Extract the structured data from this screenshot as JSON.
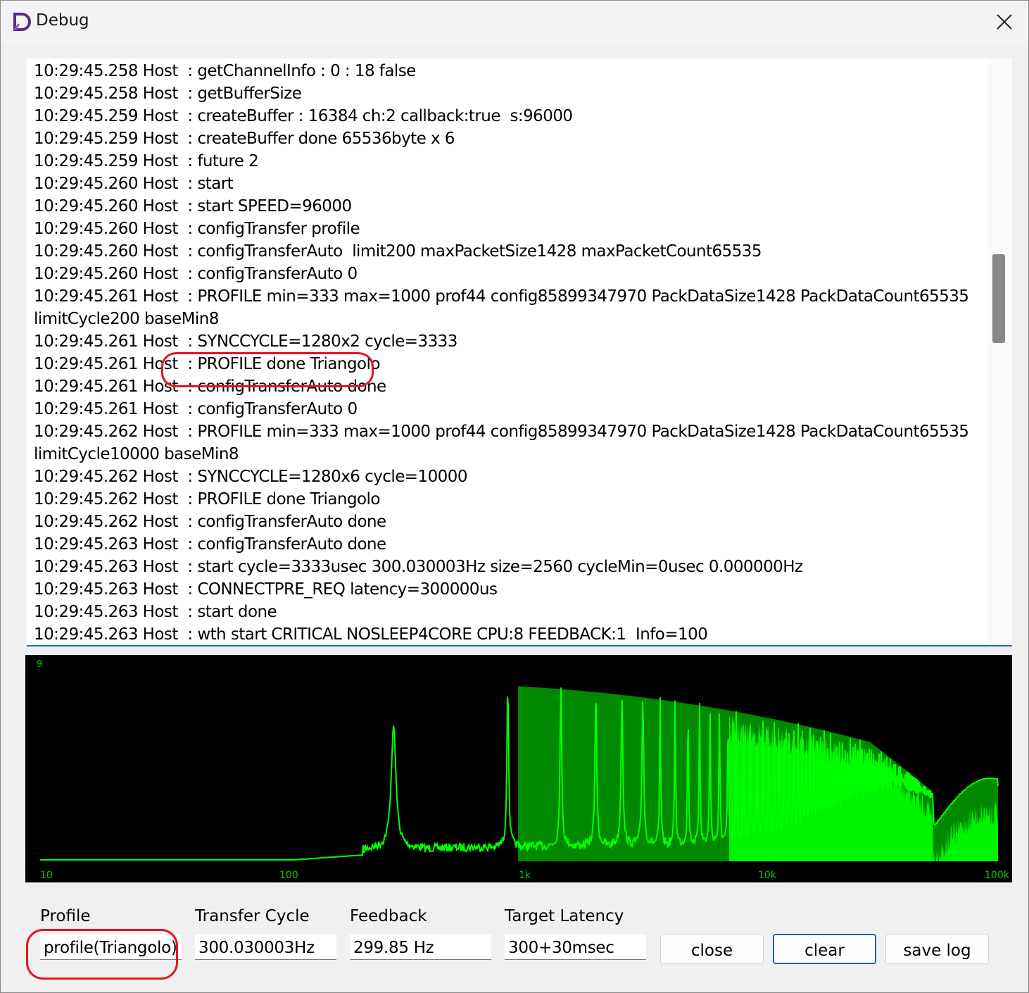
{
  "window": {
    "title": "Debug",
    "colors": {
      "brand": "#5b2a86",
      "spectrum_line": "#00ff00",
      "spectrum_fill": "#008800",
      "annotation": "#e8141e",
      "focus_border": "#1f5fa8"
    }
  },
  "log": {
    "lines": [
      "10:29:45.258 Host  : getChannelInfo : 0 : 18 false",
      "10:29:45.258 Host  : getBufferSize",
      "10:29:45.259 Host  : createBuffer : 16384 ch:2 callback:true  s:96000",
      "10:29:45.259 Host  : createBuffer done 65536byte x 6",
      "10:29:45.259 Host  : future 2",
      "10:29:45.260 Host  : start",
      "10:29:45.260 Host  : start SPEED=96000",
      "10:29:45.260 Host  : configTransfer profile",
      "10:29:45.260 Host  : configTransferAuto  limit200 maxPacketSize1428 maxPacketCount65535",
      "10:29:45.260 Host  : configTransferAuto 0",
      "10:29:45.261 Host  : PROFILE min=333 max=1000 prof44 config85899347970 PackDataSize1428 PackDataCount65535",
      "limitCycle200 baseMin8",
      "10:29:45.261 Host  : SYNCCYCLE=1280x2 cycle=3333",
      "10:29:45.261 Host  : PROFILE done Triangolo",
      "10:29:45.261 Host  : configTransferAuto done",
      "10:29:45.261 Host  : configTransferAuto 0",
      "10:29:45.262 Host  : PROFILE min=333 max=1000 prof44 config85899347970 PackDataSize1428 PackDataCount65535",
      "limitCycle10000 baseMin8",
      "10:29:45.262 Host  : SYNCCYCLE=1280x6 cycle=10000",
      "10:29:45.262 Host  : PROFILE done Triangolo",
      "10:29:45.262 Host  : configTransferAuto done",
      "10:29:45.263 Host  : configTransferAuto done",
      "10:29:45.263 Host  : start cycle=3333usec 300.030003Hz size=2560 cycleMin=0usec 0.000000Hz",
      "10:29:45.263 Host  : CONNECTPRE_REQ latency=300000us",
      "10:29:45.263 Host  : start done",
      "10:29:45.263 Host  : wth start CRITICAL NOSLEEP4CORE CPU:8 FEEDBACK:1  Info=100"
    ]
  },
  "spectrum": {
    "y_label": "9",
    "x_ticks": [
      "10",
      "100",
      "1k",
      "10k",
      "100k"
    ],
    "x_scale": "log",
    "x_range": [
      10,
      100000
    ]
  },
  "fields": {
    "profile": {
      "label": "Profile",
      "value": "profile(Triangolo)"
    },
    "transfer_cycle": {
      "label": "Transfer Cycle",
      "value": "300.030003Hz"
    },
    "feedback": {
      "label": "Feedback",
      "value": "299.85 Hz"
    },
    "target_latency": {
      "label": "Target Latency",
      "value": "300+30msec"
    }
  },
  "buttons": {
    "close": "close",
    "clear": "clear",
    "save_log": "save log"
  }
}
